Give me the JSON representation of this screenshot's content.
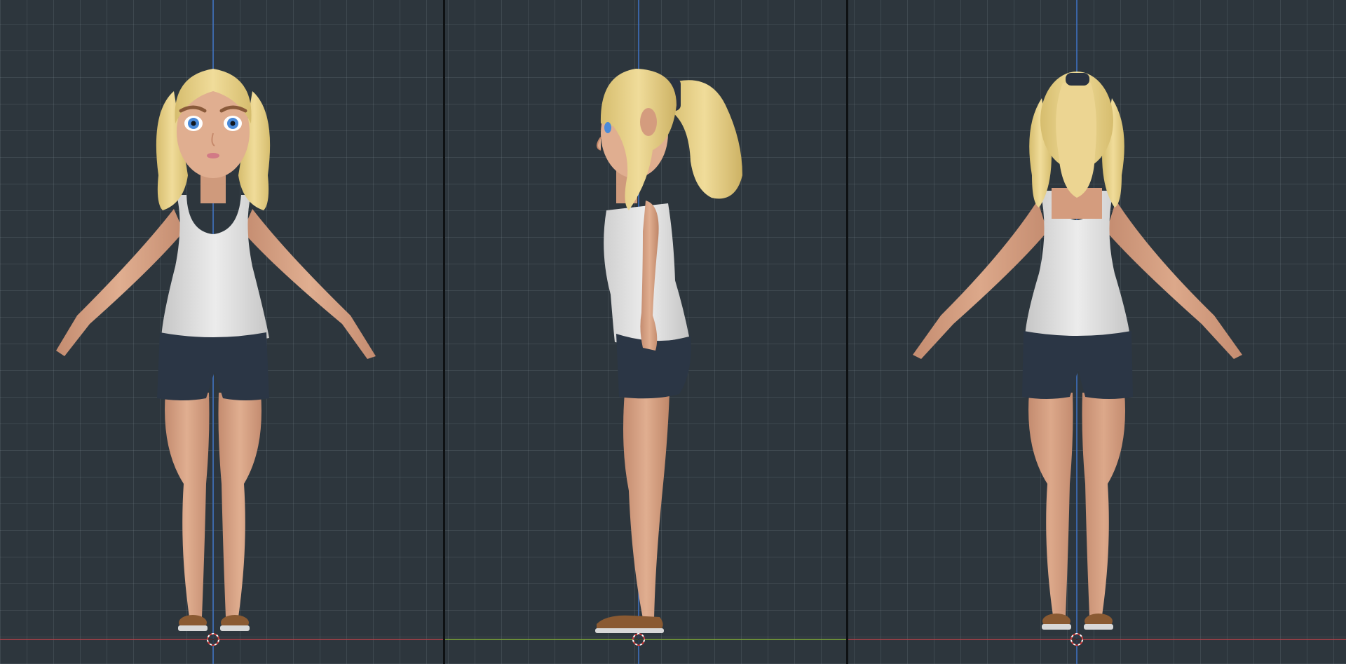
{
  "viewports": [
    {
      "id": "front",
      "view": "front",
      "ground_axis": "x",
      "ground_color": "#b0424a"
    },
    {
      "id": "side",
      "view": "right",
      "ground_axis": "y",
      "ground_color": "#7ea838"
    },
    {
      "id": "back",
      "view": "back",
      "ground_axis": "x",
      "ground_color": "#b0424a"
    }
  ],
  "vertical_axis_color": "#3e74c8",
  "colors": {
    "background": "#2d363d",
    "grid": "#5a6670",
    "hair": "#e8d28c",
    "skin": "#d9a78a",
    "tank_top": "#dcdcdc",
    "shorts": "#2b3645",
    "shoes": "#8a5a32",
    "eyes": "#4a8ad8"
  },
  "icons": [
    "origin-cursor-icon"
  ]
}
